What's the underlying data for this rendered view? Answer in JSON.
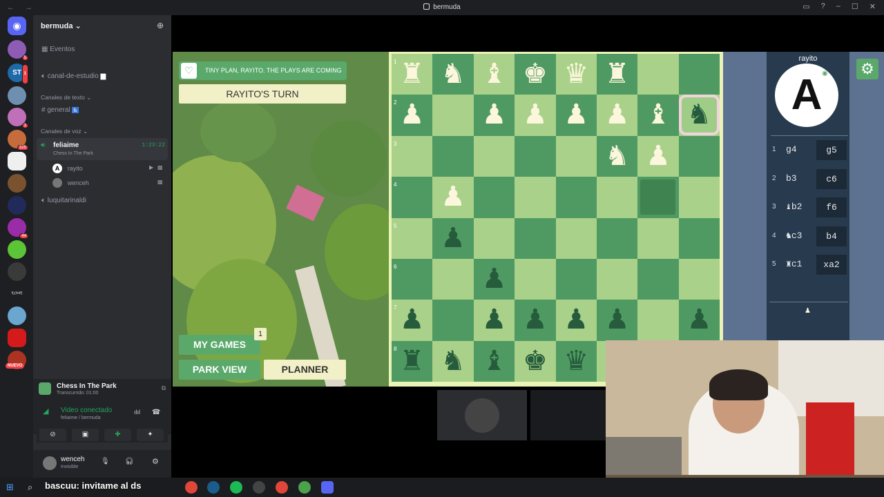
{
  "window": {
    "title": "bermuda"
  },
  "server": {
    "name": "bermuda",
    "events_label": "Eventos",
    "study_channel": "canal-de-estudio",
    "text_category": "Canales de texto",
    "text_channels": [
      "general"
    ],
    "voice_category": "Canales de voz",
    "active_voice": {
      "name": "feliaime",
      "timer": "1:23:22",
      "activity": "Chess In The Park"
    },
    "voice_members": [
      "rayito",
      "wenceh"
    ],
    "other_voice": "luquitarinaldi"
  },
  "guild_badges": [
    "5",
    "1",
    "325",
    "1",
    "44"
  ],
  "guild_labels": {
    "new": "NUEVO",
    "fyd": "f(y)hdf)"
  },
  "activity_card": {
    "title": "Chess In The Park",
    "subtitle": "Transcurrido: 01:00"
  },
  "voice_status": {
    "title": "Video conectado",
    "subtitle": "feliaime / bermuda"
  },
  "user_panel": {
    "name": "wenceh",
    "status": "Invisible"
  },
  "game": {
    "banner": "TINY PLAN, RAYITO. THE PLAYS ARE COMING",
    "turn": "RAYITO'S TURN",
    "my_games_label": "MY GAMES",
    "my_games_count": "1",
    "park_view_label": "PARK VIEW",
    "planner_label": "PLANNER",
    "player_name": "rayito",
    "player_avatar_letter": "A",
    "rank_labels": [
      "1",
      "2",
      "3",
      "4",
      "5",
      "6",
      "7",
      "8"
    ],
    "moves": [
      {
        "n": "1",
        "w": "g4",
        "b": "g5"
      },
      {
        "n": "2",
        "w": "b3",
        "b": "c6"
      },
      {
        "n": "3",
        "w": "♝b2",
        "b": "f6"
      },
      {
        "n": "4",
        "w": "♞c3",
        "b": "b4"
      },
      {
        "n": "5",
        "w": "♜c1",
        "b": "xa2"
      }
    ]
  },
  "chat_overlay": "bascuu: invitame al ds",
  "colors": {
    "board_light": "#a9d18a",
    "board_dark": "#4f9a62",
    "light_piece": "#fbf6dc",
    "dark_piece": "#265c3c",
    "accent": "#5aa96b"
  }
}
